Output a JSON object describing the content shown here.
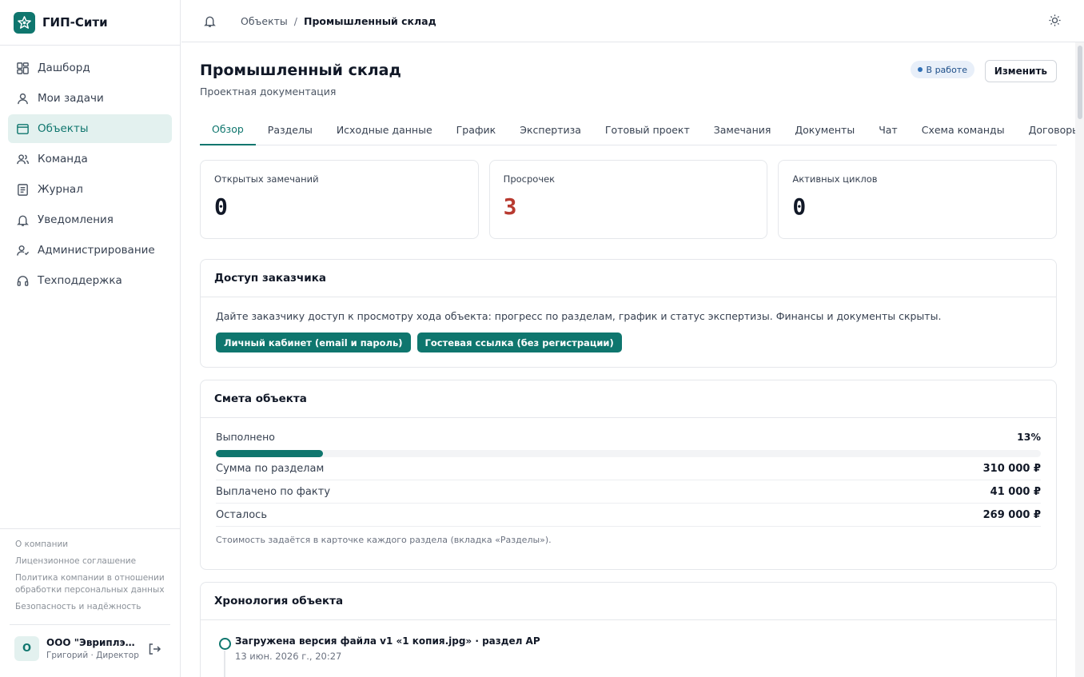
{
  "brand": {
    "name": "ГИП-Сити"
  },
  "sidebar": {
    "items": [
      {
        "label": "Дашборд",
        "icon": "dashboard-icon"
      },
      {
        "label": "Мои задачи",
        "icon": "user-icon"
      },
      {
        "label": "Объекты",
        "icon": "folder-icon",
        "active": true
      },
      {
        "label": "Команда",
        "icon": "team-icon"
      },
      {
        "label": "Журнал",
        "icon": "journal-icon"
      },
      {
        "label": "Уведомления",
        "icon": "bell-icon"
      },
      {
        "label": "Администрирование",
        "icon": "admin-icon"
      },
      {
        "label": "Техподдержка",
        "icon": "headset-icon"
      }
    ],
    "footer_links": [
      "О компании",
      "Лицензионное соглашение",
      "Политика компании в отношении обработки персональных данных",
      "Безопасность и надёжность"
    ],
    "user": {
      "avatar": "О",
      "name": "ООО \"Эвриплэй...",
      "role": "Григорий · Директор"
    }
  },
  "breadcrumb": {
    "parent": "Объекты",
    "separator": "/",
    "current": "Промышленный склад"
  },
  "page": {
    "title": "Промышленный склад",
    "subtitle": "Проектная документация",
    "status": "В работе",
    "edit_label": "Изменить"
  },
  "tabs": [
    {
      "label": "Обзор",
      "active": true
    },
    {
      "label": "Разделы"
    },
    {
      "label": "Исходные данные"
    },
    {
      "label": "График"
    },
    {
      "label": "Экспертиза"
    },
    {
      "label": "Готовый проект"
    },
    {
      "label": "Замечания"
    },
    {
      "label": "Документы"
    },
    {
      "label": "Чат"
    },
    {
      "label": "Схема команды"
    },
    {
      "label": "Договоры"
    }
  ],
  "stats": [
    {
      "label": "Открытых замечаний",
      "value": "0"
    },
    {
      "label": "Просрочек",
      "value": "3",
      "alert": true
    },
    {
      "label": "Активных циклов",
      "value": "0"
    }
  ],
  "client_access": {
    "title": "Доступ заказчика",
    "description": "Дайте заказчику доступ к просмотру хода объекта: прогресс по разделам, график и статус экспертизы. Финансы и документы скрыты.",
    "buttons": [
      "Личный кабинет (email и пароль)",
      "Гостевая ссылка (без регистрации)"
    ]
  },
  "estimate": {
    "title": "Смета объекта",
    "progress_label": "Выполнено",
    "progress_percent": 13,
    "progress_text": "13%",
    "rows": [
      {
        "label": "Сумма по разделам",
        "value": "310 000 ₽"
      },
      {
        "label": "Выплачено по факту",
        "value": "41 000 ₽"
      },
      {
        "label": "Осталось",
        "value": "269 000 ₽"
      }
    ],
    "note": "Стоимость задаётся в карточке каждого раздела (вкладка «Разделы»)."
  },
  "timeline": {
    "title": "Хронология объекта",
    "events": [
      {
        "title": "Загружена версия файла v1 «1 копия.jpg» · раздел АР",
        "time": "13 июн. 2026 г., 20:27"
      }
    ]
  },
  "colors": {
    "accent": "#0f766e",
    "alert": "#b83a30",
    "status_bg": "#e8eff9"
  }
}
